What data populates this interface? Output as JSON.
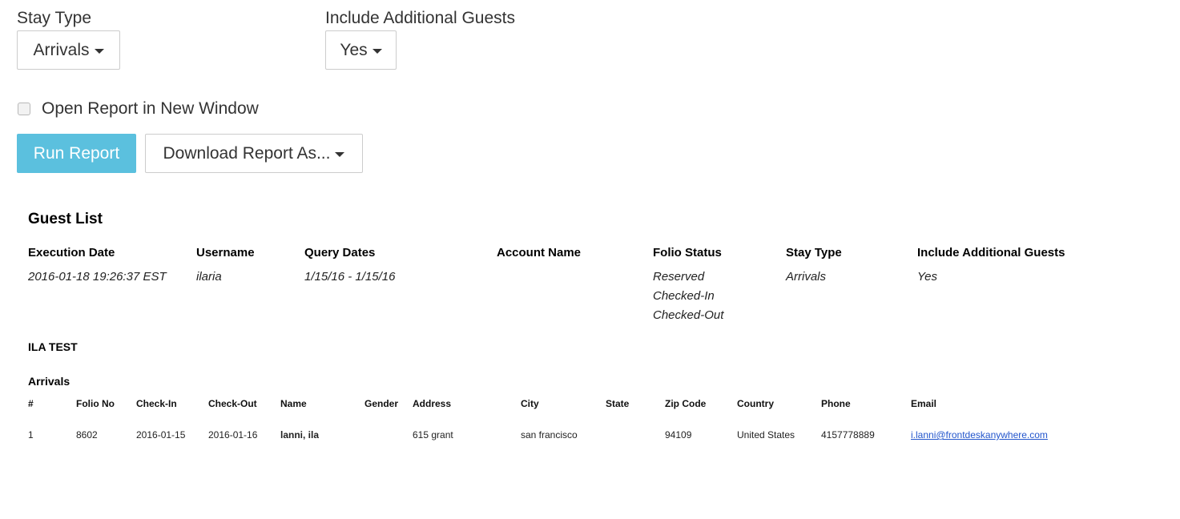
{
  "filters": {
    "stay_type_label": "Stay Type",
    "stay_type_value": "Arrivals",
    "additional_guests_label": "Include Additional Guests",
    "additional_guests_value": "Yes",
    "new_window_label": "Open Report in New Window",
    "new_window_checked": false
  },
  "actions": {
    "run_label": "Run Report",
    "download_label": "Download Report As...",
    "run_color": "#5bc0de"
  },
  "report": {
    "title": "Guest List",
    "meta": {
      "execution_date_label": "Execution Date",
      "execution_date": "2016-01-18 19:26:37 EST",
      "username_label": "Username",
      "username": "ilaria",
      "query_dates_label": "Query Dates",
      "query_dates": "1/15/16 - 1/15/16",
      "account_name_label": "Account Name",
      "account_name": "",
      "folio_status_label": "Folio Status",
      "folio_status": [
        "Reserved",
        "Checked-In",
        "Checked-Out"
      ],
      "stay_type_label": "Stay Type",
      "stay_type": "Arrivals",
      "additional_guests_label": "Include Additional Guests",
      "additional_guests": "Yes"
    },
    "account_heading": "ILA TEST",
    "section_heading": "Arrivals",
    "table": {
      "headers": [
        "#",
        "Folio No",
        "Check-In",
        "Check-Out",
        "Name",
        "Gender",
        "Address",
        "City",
        "State",
        "Zip Code",
        "Country",
        "Phone",
        "Email"
      ],
      "rows": [
        [
          "1",
          "8602",
          "2016-01-15",
          "2016-01-16",
          "lanni, ila",
          "",
          "615 grant",
          "san francisco",
          "",
          "94109",
          "United States",
          "4157778889",
          "i.lanni@frontdeskanywhere.com"
        ]
      ]
    }
  }
}
